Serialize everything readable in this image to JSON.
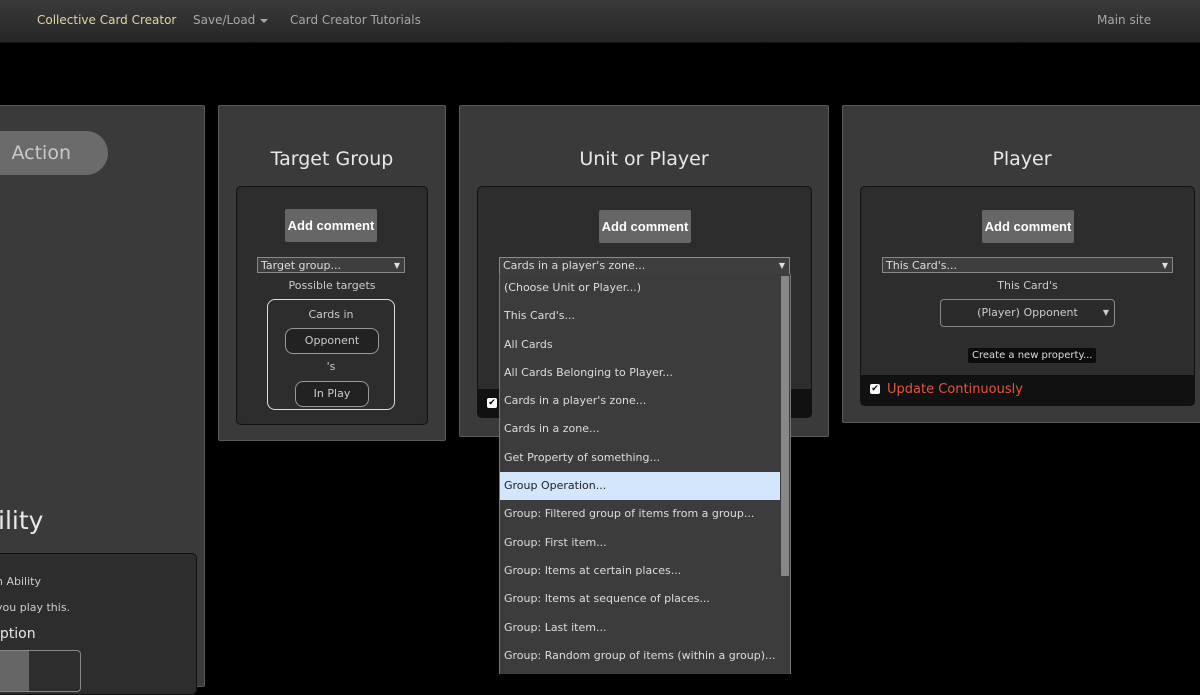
{
  "navbar": {
    "brand": "Collective Card Creator",
    "save_load": "Save/Load",
    "tutorials": "Card Creator Tutorials",
    "main_site": "Main site"
  },
  "left_panel": {
    "action_button": "Action",
    "ability_title": "ility",
    "ability_text": "n Ability",
    "play_text": "you play this.",
    "description": "iption"
  },
  "target_group": {
    "title": "Target Group",
    "add_comment": "Add comment",
    "select_value": "Target group...",
    "possible_targets": "Possible targets",
    "cards_in": "Cards in",
    "opponent": "Opponent",
    "possessive": "'s",
    "in_play": "In Play"
  },
  "unit_or_player": {
    "title": "Unit or Player",
    "add_comment": "Add comment",
    "select_value": "Cards in a player's zone...",
    "options": [
      "(Choose Unit or Player...)",
      "This Card's...",
      "All Cards",
      "All Cards Belonging to Player...",
      "Cards in a player's zone...",
      "Cards in a zone...",
      "Get Property of something...",
      "Group Operation...",
      "Group: Filtered group of items from a group...",
      "Group: First item...",
      "Group: Items at certain places...",
      "Group: Items at sequence of places...",
      "Group: Last item...",
      "Group: Random group of items (within a group)..."
    ],
    "highlighted_option": "Group Operation..."
  },
  "player": {
    "title": "Player",
    "add_comment": "Add comment",
    "select_value": "This Card's...",
    "this_cards_label": "This Card's",
    "player_select": "(Player) Opponent",
    "create_property": "Create a new property...",
    "update_continuously": "Update Continuously"
  },
  "colors": {
    "brand": "#e4d3a6",
    "update_text": "#e8543a",
    "highlight": "#d3e6fb"
  }
}
